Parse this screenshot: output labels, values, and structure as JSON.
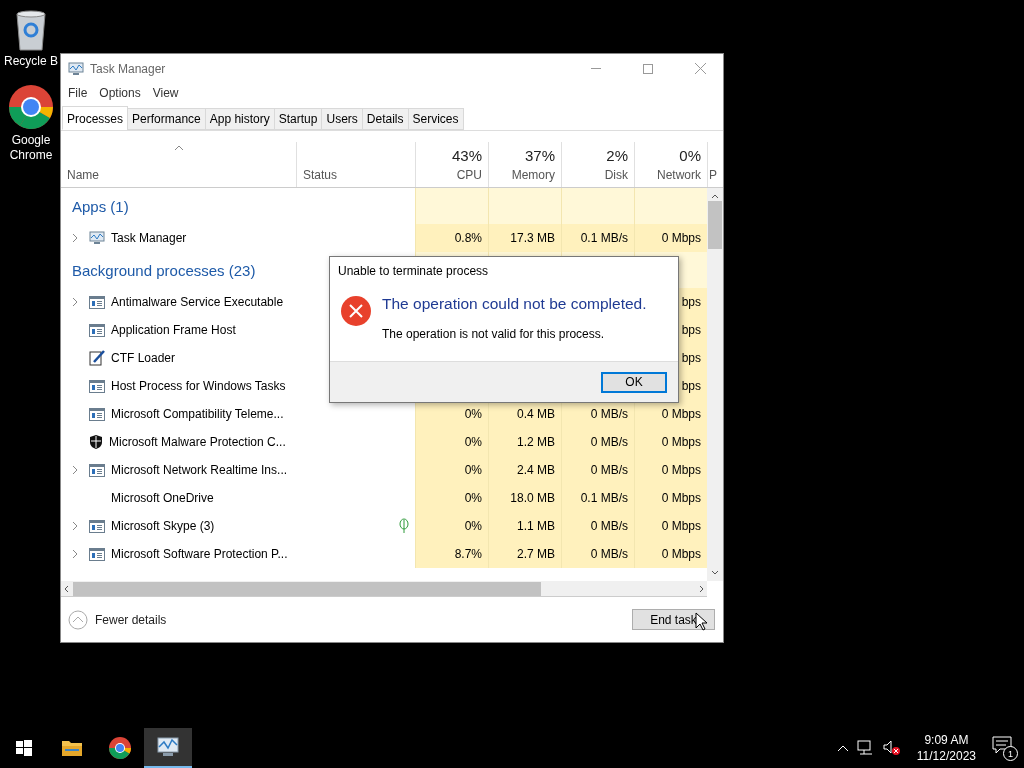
{
  "desktop": {
    "icons": [
      {
        "label": "Recycle B",
        "kind": "bin"
      },
      {
        "label": "Google Chrome",
        "kind": "browser"
      }
    ]
  },
  "window": {
    "title": "Task Manager",
    "menu": [
      "File",
      "Options",
      "View"
    ],
    "tabs": [
      {
        "label": "Processes",
        "selected": true
      },
      {
        "label": "Performance",
        "selected": false
      },
      {
        "label": "App history",
        "selected": false
      },
      {
        "label": "Startup",
        "selected": false
      },
      {
        "label": "Users",
        "selected": false
      },
      {
        "label": "Details",
        "selected": false
      },
      {
        "label": "Services",
        "selected": false
      }
    ],
    "columns": [
      {
        "label": "Name",
        "sorted": true
      },
      {
        "label": "Status",
        "sorted": false
      },
      {
        "label": "CPU",
        "usage": "43%",
        "sorted": false
      },
      {
        "label": "Memory",
        "usage": "37%",
        "sorted": false
      },
      {
        "label": "Disk",
        "usage": "2%",
        "sorted": false
      },
      {
        "label": "Network",
        "usage": "0%",
        "sorted": false
      },
      {
        "label": "P",
        "sorted": false
      }
    ],
    "rows": [
      {
        "kind": "group",
        "name": "Apps (1)"
      },
      {
        "kind": "app",
        "name": "Task Manager",
        "expandable": true,
        "suspended": false,
        "cpu": "0.8%",
        "memory": "17.3 MB",
        "disk": "0.1 MB/s",
        "network": "0 Mbps"
      },
      {
        "kind": "group",
        "name": "Background processes (23)"
      },
      {
        "kind": "service",
        "name": "Antimalware Service Executable",
        "expandable": true,
        "suspended": false,
        "network": "bps"
      },
      {
        "kind": "service",
        "name": "Application Frame Host",
        "expandable": false,
        "suspended": false,
        "network": "bps"
      },
      {
        "kind": "editor",
        "name": "CTF Loader",
        "expandable": false,
        "suspended": false,
        "network": "bps"
      },
      {
        "kind": "service",
        "name": "Host Process for Windows Tasks",
        "expandable": false,
        "suspended": false,
        "network": "bps"
      },
      {
        "kind": "service",
        "name": "Microsoft Compatibility Teleme...",
        "expandable": false,
        "suspended": false,
        "cpu": "0%",
        "memory": "0.4 MB",
        "disk": "0 MB/s",
        "network": "0 Mbps"
      },
      {
        "kind": "shield",
        "name": "Microsoft Malware Protection C...",
        "expandable": false,
        "suspended": false,
        "cpu": "0%",
        "memory": "1.2 MB",
        "disk": "0 MB/s",
        "network": "0 Mbps"
      },
      {
        "kind": "service",
        "name": "Microsoft Network Realtime Ins...",
        "expandable": true,
        "suspended": false,
        "cpu": "0%",
        "memory": "2.4 MB",
        "disk": "0 MB/s",
        "network": "0 Mbps"
      },
      {
        "kind": "plain",
        "name": "Microsoft OneDrive",
        "expandable": false,
        "suspended": false,
        "cpu": "0%",
        "memory": "18.0 MB",
        "disk": "0.1 MB/s",
        "network": "0 Mbps"
      },
      {
        "kind": "service",
        "name": "Microsoft Skype (3)",
        "expandable": true,
        "suspended": true,
        "cpu": "0%",
        "memory": "1.1 MB",
        "disk": "0 MB/s",
        "network": "0 Mbps"
      },
      {
        "kind": "service",
        "name": "Microsoft Software Protection P...",
        "expandable": true,
        "suspended": false,
        "cpu": "8.7%",
        "memory": "2.7 MB",
        "disk": "0 MB/s",
        "network": "0 Mbps"
      }
    ],
    "footer": {
      "toggle": "Fewer details",
      "button": "End task"
    }
  },
  "dialog": {
    "title": "Unable to terminate process",
    "heading": "The operation could not be completed.",
    "message": "The operation is not valid for this process.",
    "button": "OK"
  },
  "taskbar": {
    "apps": [
      {
        "kind": "folder",
        "selected": false
      },
      {
        "kind": "browser",
        "selected": false
      },
      {
        "kind": "taskmgr",
        "selected": true
      }
    ],
    "time": "9:09 AM",
    "date": "11/12/2023",
    "notifications": "1"
  }
}
